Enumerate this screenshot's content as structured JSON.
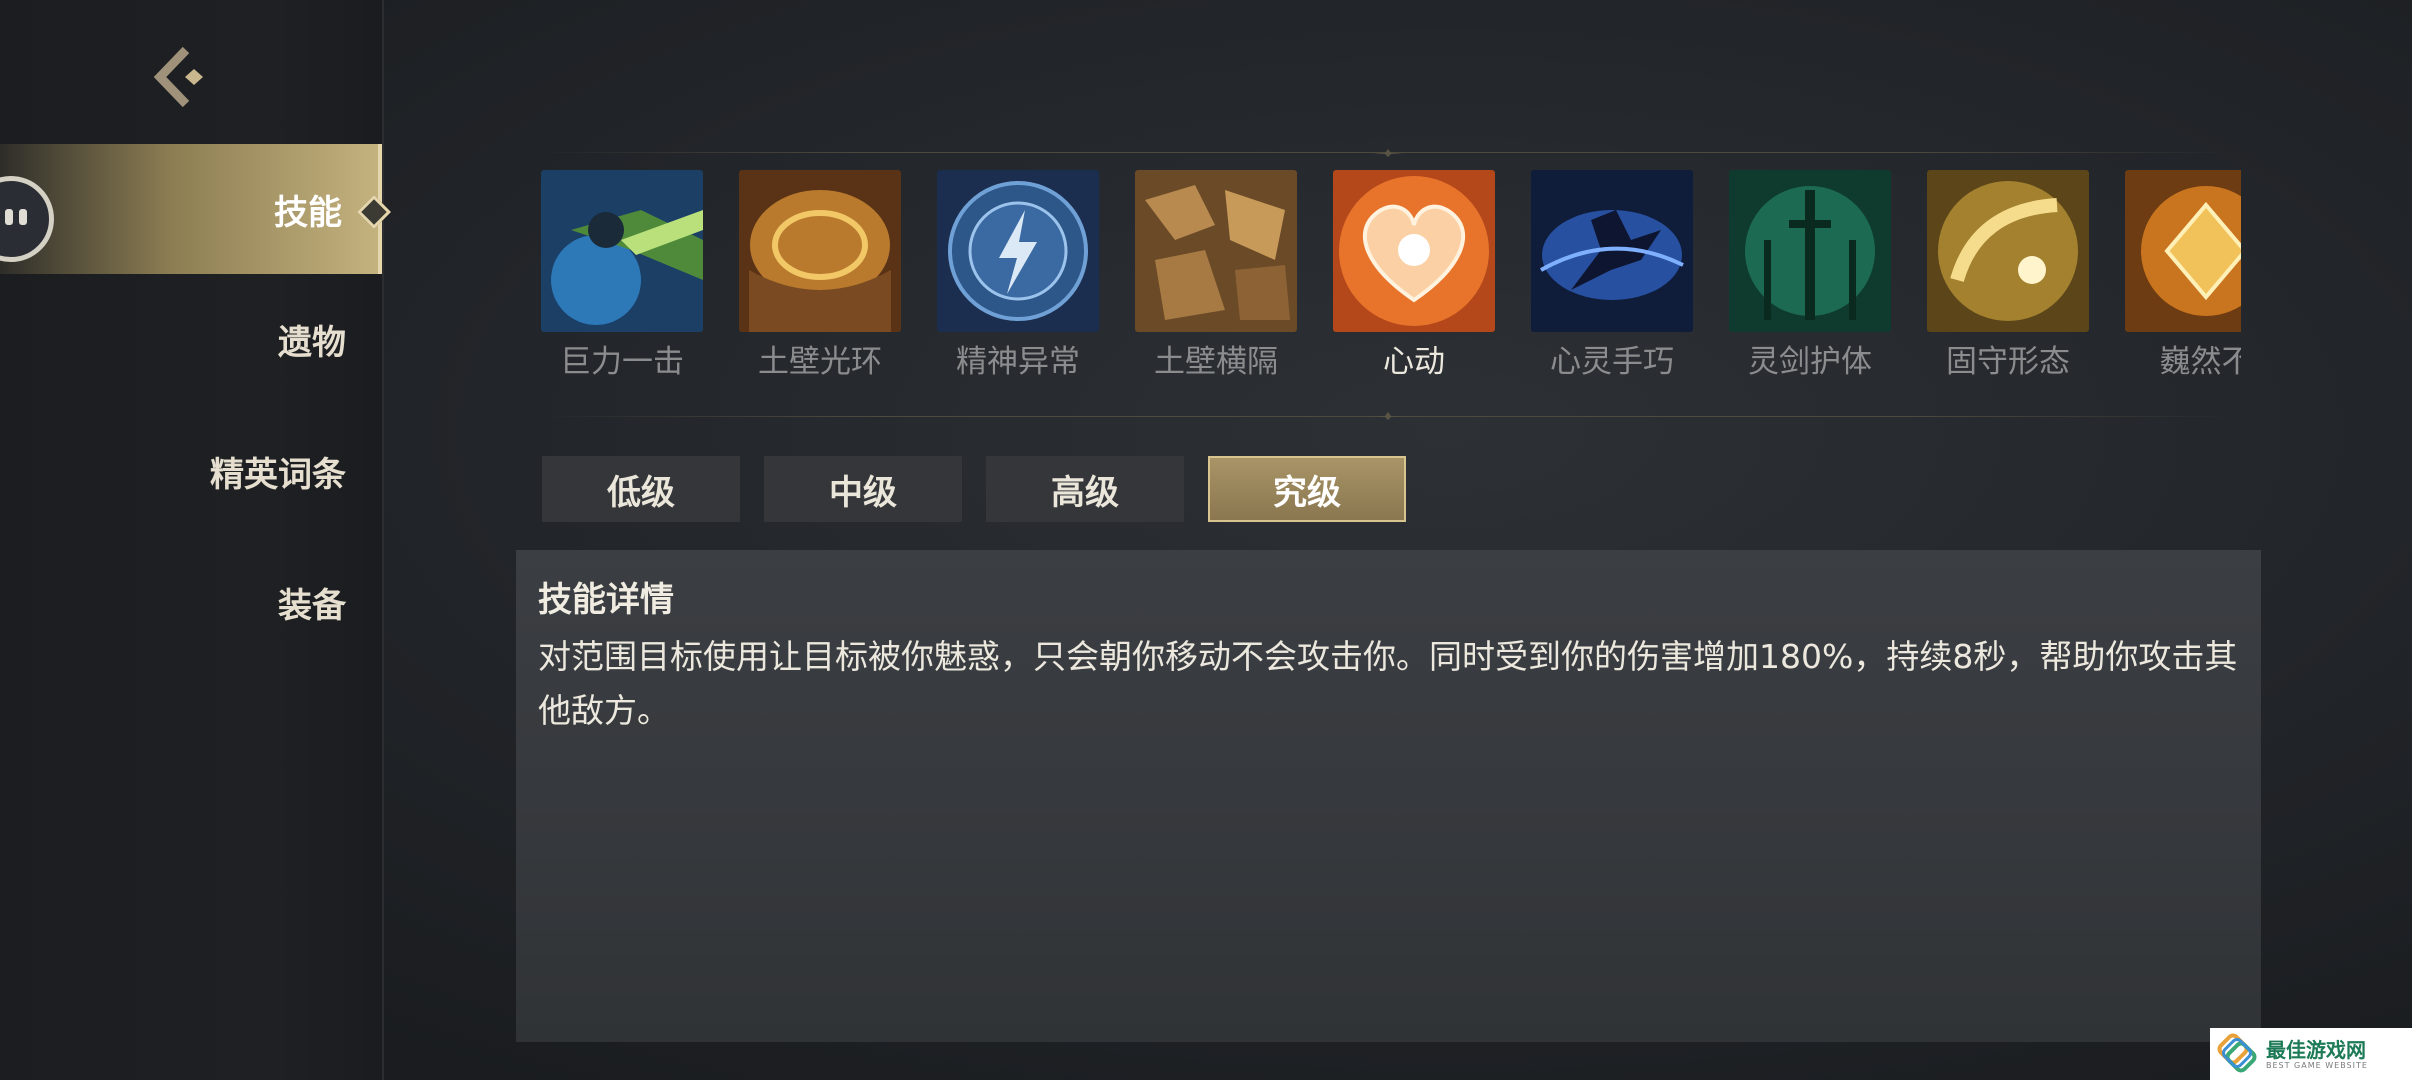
{
  "nav": {
    "items": [
      {
        "label": "技能",
        "active": true
      },
      {
        "label": "遗物",
        "active": false
      },
      {
        "label": "精英词条",
        "active": false
      },
      {
        "label": "装备",
        "active": false
      }
    ]
  },
  "skills": [
    {
      "label": "巨力一击",
      "selected": false,
      "icon": "giant-strike-icon"
    },
    {
      "label": "土壁光环",
      "selected": false,
      "icon": "earth-wall-aura-icon"
    },
    {
      "label": "精神异常",
      "selected": false,
      "icon": "mental-anomaly-icon"
    },
    {
      "label": "土壁横隔",
      "selected": false,
      "icon": "earth-wall-barrier-icon"
    },
    {
      "label": "心动",
      "selected": true,
      "icon": "heart-icon"
    },
    {
      "label": "心灵手巧",
      "selected": false,
      "icon": "dexterity-icon"
    },
    {
      "label": "灵剑护体",
      "selected": false,
      "icon": "spirit-swords-icon"
    },
    {
      "label": "固守形态",
      "selected": false,
      "icon": "hold-stance-icon"
    },
    {
      "label": "巍然不",
      "selected": false,
      "icon": "steadfast-icon"
    }
  ],
  "tiers": [
    {
      "label": "低级",
      "active": false
    },
    {
      "label": "中级",
      "active": false
    },
    {
      "label": "高级",
      "active": false
    },
    {
      "label": "究级",
      "active": true
    }
  ],
  "details": {
    "title": "技能详情",
    "text": "对范围目标使用让目标被你魅惑，只会朝你移动不会攻击你。同时受到你的伤害增加180%，持续8秒，帮助你攻击其他敌方。"
  },
  "watermark": {
    "title": "最佳游戏网",
    "subtitle": "BEST GAME WEBSITE"
  },
  "colors": {
    "accent_gold": "#c4b27e",
    "tier_active": "#9a8659",
    "panel_bg": "#383b3f"
  }
}
